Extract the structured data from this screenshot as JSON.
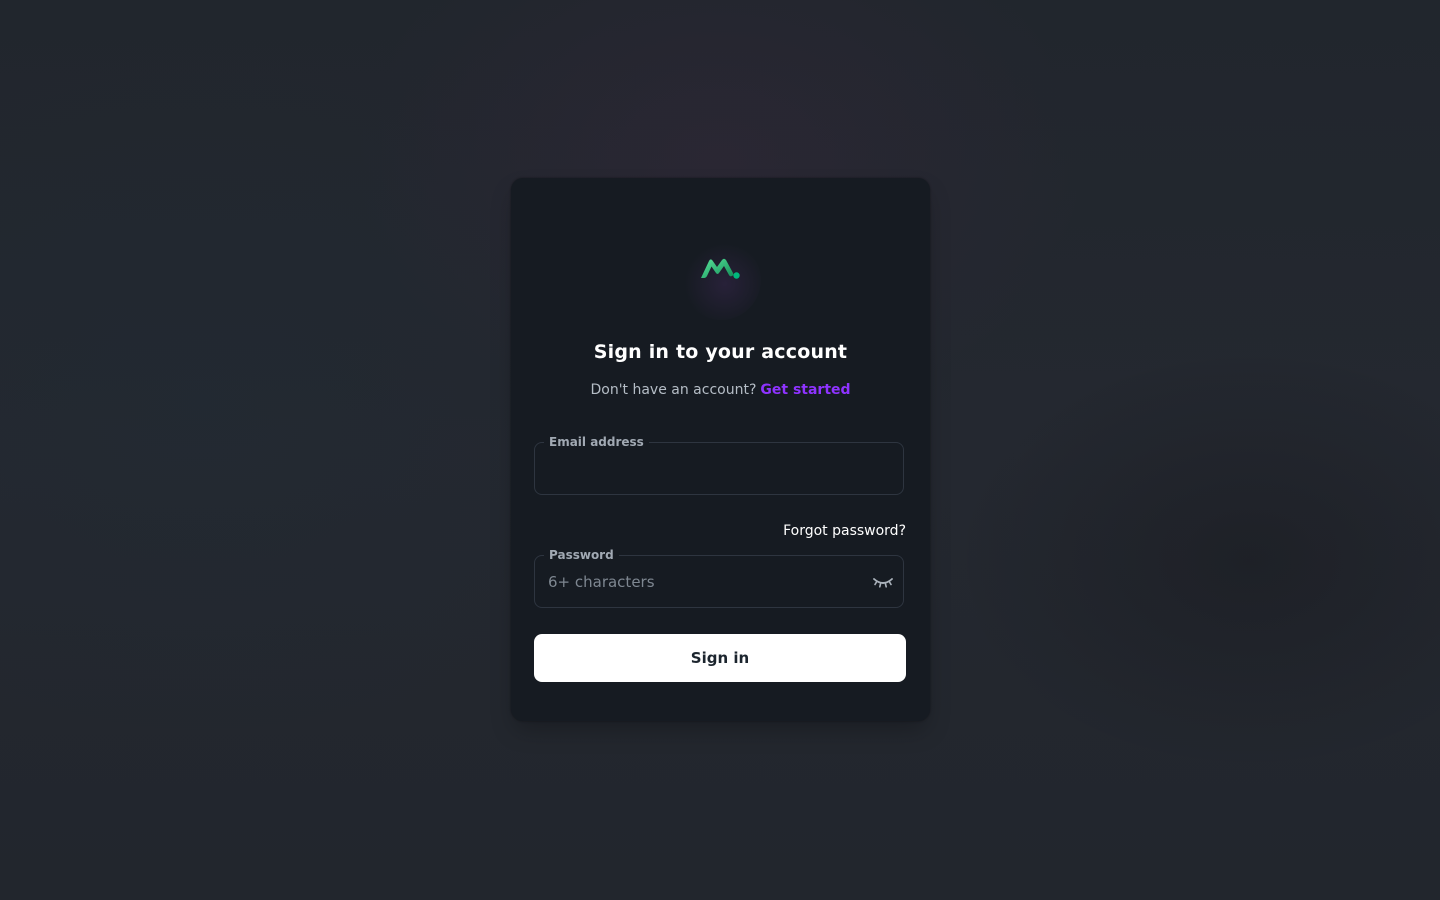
{
  "auth": {
    "title": "Sign in to your account",
    "subtitle_text": "Don't have an account?",
    "get_started_link": "Get started",
    "email_label": "Email address",
    "email_value": "",
    "forgot_password_link": "Forgot password?",
    "password_label": "Password",
    "password_placeholder": "6+ characters",
    "password_value": "",
    "sign_in_button": "Sign in"
  },
  "icons": {
    "logo": "brand-logo-icon",
    "password_visibility": "eye-closed-icon"
  },
  "colors": {
    "page_background": "#22262d",
    "card_background": "#161b22",
    "accent_link": "#8e33ff",
    "logo_green": "#22c55e",
    "button_background": "#ffffff",
    "button_text": "#1c252e"
  }
}
